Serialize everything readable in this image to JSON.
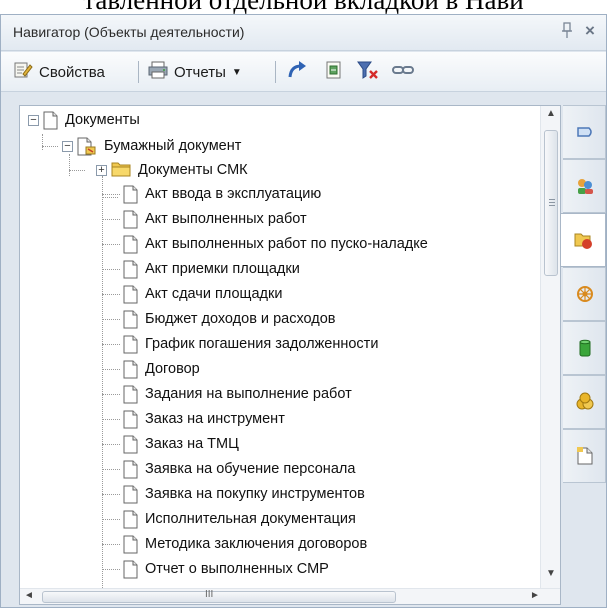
{
  "caption_fragment": "тавленной отдельной вкладкой в Нави",
  "window": {
    "title": "Навигатор (Объекты деятельности)",
    "pin_glyph": "∗",
    "close_glyph": "×"
  },
  "toolbar": {
    "properties_label": "Свойства",
    "reports_label": "Отчеты",
    "icons": [
      "properties-icon",
      "reports-icon",
      "dropdown-arrow-icon",
      "refresh-icon",
      "export-icon",
      "clear-filter-icon",
      "link-icon"
    ]
  },
  "tree": {
    "root_label": "Документы",
    "paper_doc_label": "Бумажный документ",
    "folder_label": "Документы СМК",
    "items": [
      "Акт ввода в эксплуатацию",
      "Акт выполненных работ",
      "Акт выполненных работ по пуско-наладке",
      "Акт приемки площадки",
      "Акт сдачи площадки",
      "Бюджет доходов и расходов",
      "График погашения задолженности",
      "Договор",
      "Задания на выполнение работ",
      "Заказ на инструмент",
      "Заказ на ТМЦ",
      "Заявка на обучение персонала",
      "Заявка на покупку инструментов",
      "Исполнительная документация",
      "Методика заключения договоров",
      "Отчет о выполненных СМР"
    ]
  },
  "scrollbars": {
    "vertical_grip": "≡",
    "horizontal_grip": "III"
  },
  "side_tabs": [
    "message-tab",
    "users-tab",
    "objects-tab",
    "wheel-tab",
    "database-tab",
    "groups-tab",
    "document-tab"
  ],
  "colors": {
    "accent": "#2f63b4",
    "folder": "#f0c850",
    "panel": "#dfe6ee"
  }
}
